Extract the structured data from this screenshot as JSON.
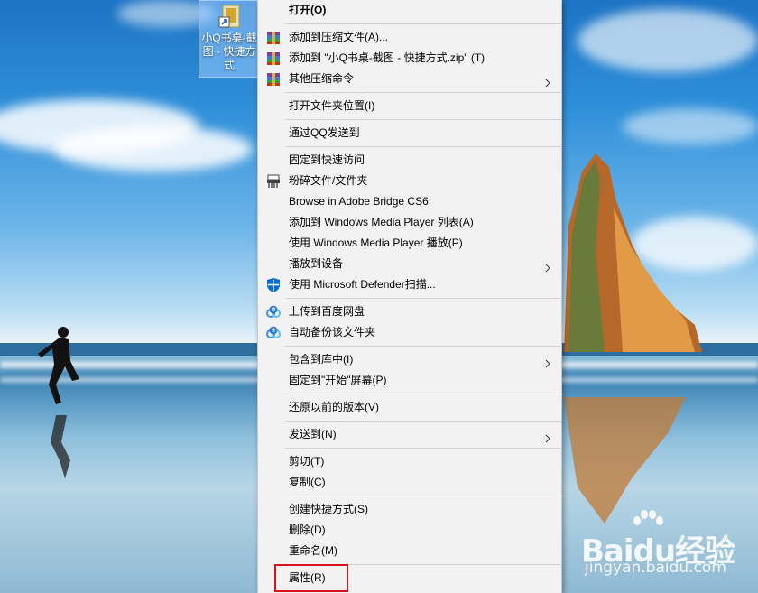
{
  "desktop": {
    "shortcut": {
      "label": "小Q书桌-截图 - 快捷方式"
    }
  },
  "context_menu": {
    "items": [
      {
        "label": "打开(O)",
        "bold": true
      },
      {
        "label": "添加到压缩文件(A)...",
        "icon": "winrar-icon"
      },
      {
        "label": "添加到 \"小Q书桌-截图 - 快捷方式.zip\" (T)",
        "icon": "winrar-icon"
      },
      {
        "label": "其他压缩命令",
        "icon": "winrar-icon",
        "submenu": true
      },
      {
        "label": "打开文件夹位置(I)"
      },
      {
        "label": "通过QQ发送到"
      },
      {
        "label": "固定到快速访问"
      },
      {
        "label": "粉碎文件/文件夹",
        "icon": "shredder-icon"
      },
      {
        "label": "Browse in Adobe Bridge CS6"
      },
      {
        "label": "添加到 Windows Media Player 列表(A)"
      },
      {
        "label": "使用 Windows Media Player 播放(P)"
      },
      {
        "label": "播放到设备",
        "submenu": true
      },
      {
        "label": "使用 Microsoft Defender扫描...",
        "icon": "defender-shield-icon"
      },
      {
        "label": "上传到百度网盘",
        "icon": "baidu-netdisk-icon"
      },
      {
        "label": "自动备份该文件夹",
        "icon": "baidu-netdisk-icon"
      },
      {
        "label": "包含到库中(I)",
        "submenu": true
      },
      {
        "label": "固定到\"开始\"屏幕(P)"
      },
      {
        "label": "还原以前的版本(V)"
      },
      {
        "label": "发送到(N)",
        "submenu": true
      },
      {
        "label": "剪切(T)"
      },
      {
        "label": "复制(C)"
      },
      {
        "label": "创建快捷方式(S)"
      },
      {
        "label": "删除(D)"
      },
      {
        "label": "重命名(M)"
      },
      {
        "label": "属性(R)",
        "highlighted": true
      }
    ]
  },
  "watermark": {
    "brand": "Baidu经验",
    "url": "jingyan.baidu.com"
  },
  "colors": {
    "menu_bg": "#f2f2f2",
    "highlight_border": "#d6121a",
    "separator": "#d0d0d0"
  }
}
